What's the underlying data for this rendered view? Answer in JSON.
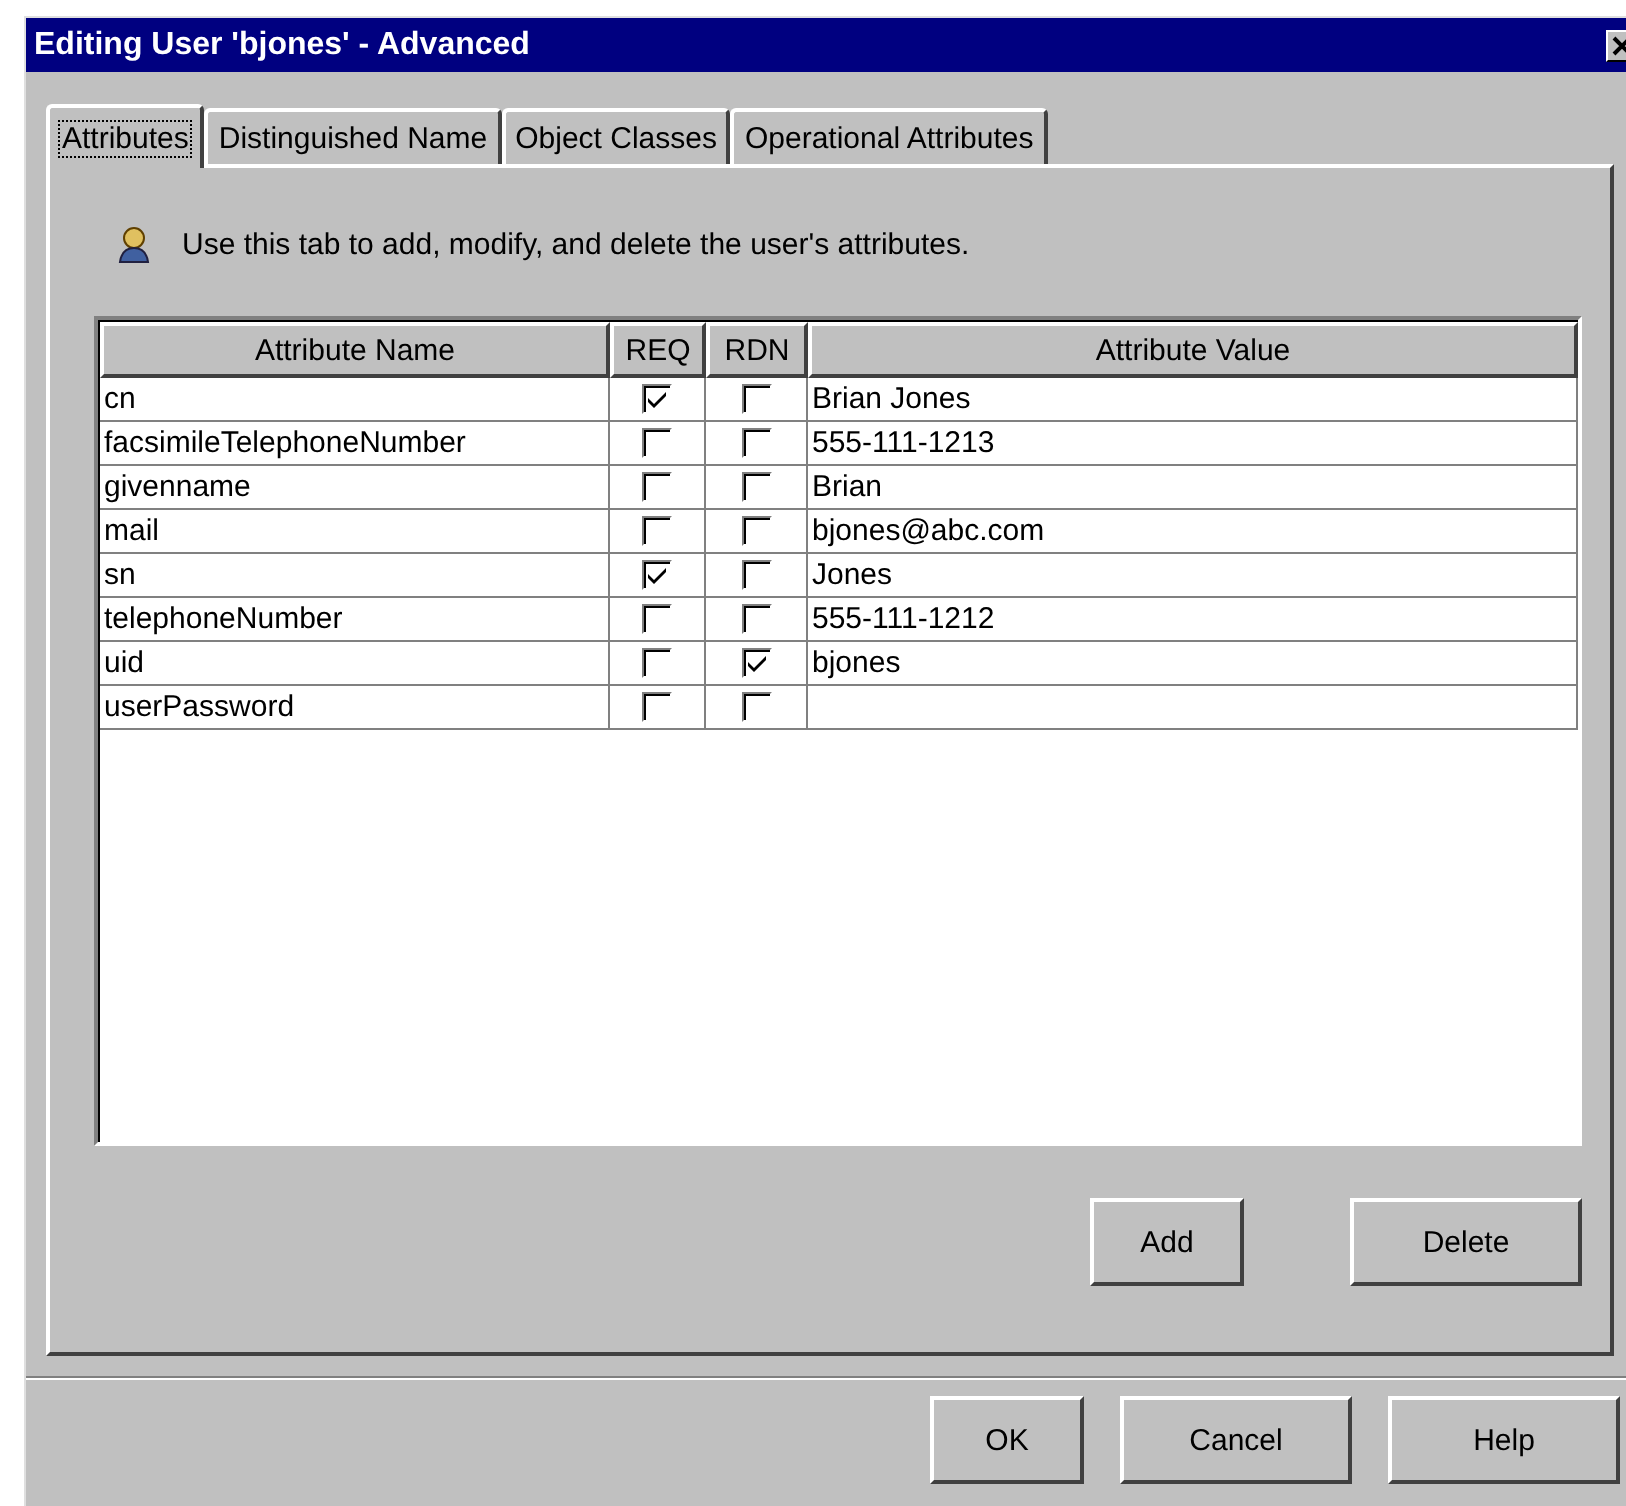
{
  "window": {
    "title": "Editing User 'bjones' - Advanced"
  },
  "tabs": [
    {
      "label": "Attributes",
      "selected": true
    },
    {
      "label": "Distinguished Name",
      "selected": false
    },
    {
      "label": "Object Classes",
      "selected": false
    },
    {
      "label": "Operational Attributes",
      "selected": false
    }
  ],
  "info": "Use this tab to add, modify, and delete the user's attributes.",
  "table": {
    "columns": [
      "Attribute Name",
      "REQ",
      "RDN",
      "Attribute Value"
    ],
    "rows": [
      {
        "name": "cn",
        "req": true,
        "rdn": false,
        "value": "Brian Jones"
      },
      {
        "name": "facsimileTelephoneNumber",
        "req": false,
        "rdn": false,
        "value": "555-111-1213"
      },
      {
        "name": "givenname",
        "req": false,
        "rdn": false,
        "value": "Brian"
      },
      {
        "name": "mail",
        "req": false,
        "rdn": false,
        "value": "bjones@abc.com"
      },
      {
        "name": "sn",
        "req": true,
        "rdn": false,
        "value": "Jones"
      },
      {
        "name": "telephoneNumber",
        "req": false,
        "rdn": false,
        "value": "555-111-1212"
      },
      {
        "name": "uid",
        "req": false,
        "rdn": true,
        "value": "bjones"
      },
      {
        "name": "userPassword",
        "req": false,
        "rdn": false
      }
    ]
  },
  "panel_buttons": [
    "Add",
    "Delete"
  ],
  "buttons": [
    "OK",
    "Cancel",
    "Help"
  ]
}
